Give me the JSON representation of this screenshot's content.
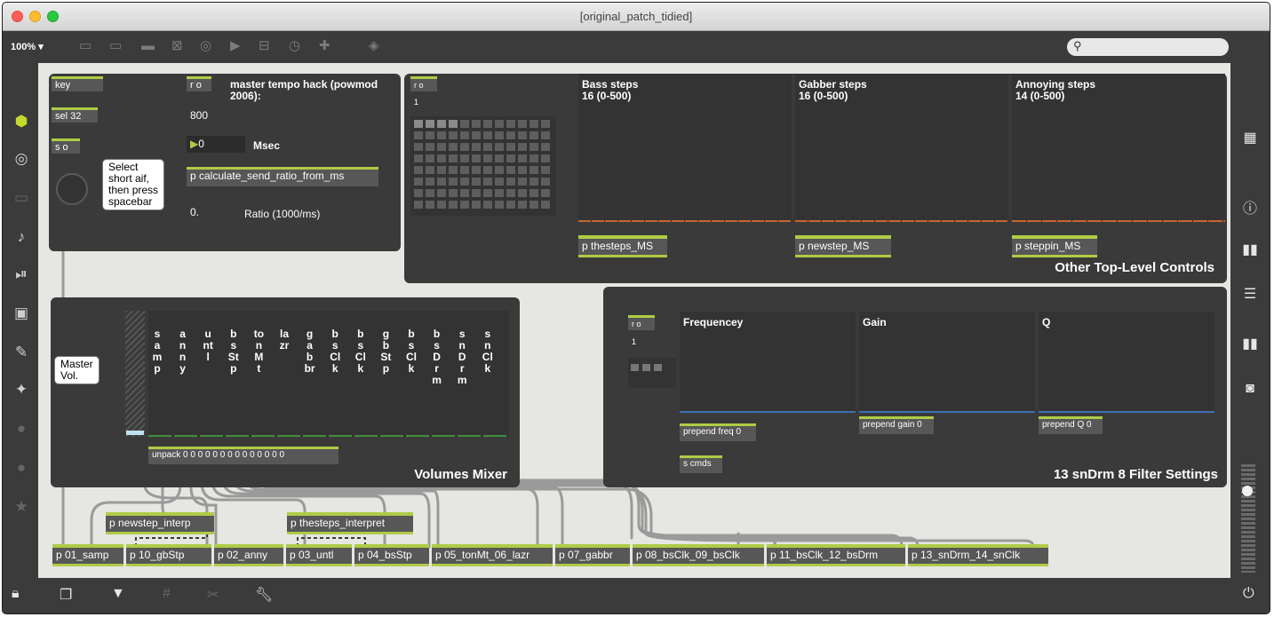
{
  "window": {
    "title": "[original_patch_tidied]"
  },
  "toolbar": {
    "zoom": "100% ▾",
    "search_glyph": "⚲"
  },
  "top_left_panel": {
    "key_label": "key",
    "sel_label": "sel 32",
    "s_o_label": "s o",
    "r_o_label": "r o",
    "heading": "master tempo hack (powmod\n2006):",
    "value_800": "800",
    "msec_value": "0",
    "msec_label": "Msec",
    "calc_label": "p calculate_send_ratio_from_ms",
    "ratio_value": "0.",
    "ratio_label": "Ratio (1000/ms)",
    "bubble_text": "Select\nshort aif,\nthen press\nspacebar"
  },
  "steps_panel": {
    "r_o_label": "r o",
    "value_1": "1",
    "plots": [
      {
        "heading": "Bass steps\n16 (0-500)",
        "patcher": "p thesteps_MS"
      },
      {
        "heading": "Gabber steps\n16 (0-500)",
        "patcher": "p newstep_MS"
      },
      {
        "heading": "Annoying steps\n14 (0-500)",
        "patcher": "p steppin_MS"
      }
    ],
    "title": "Other Top-Level Controls"
  },
  "volumes_panel": {
    "bubble_text": "Master\nVol.",
    "columns": [
      "samp",
      "anny",
      "untl",
      "bsStp",
      "tonMt",
      "lazr",
      "gabbr",
      "bsClk",
      "bsClk",
      "gbStp",
      "bsClk",
      "bsDrm",
      "snDrm",
      "snClk"
    ],
    "unpack_label": "unpack 0 0 0 0 0 0 0 0 0 0 0 0 0 0",
    "title": "Volumes Mixer"
  },
  "filter_panel": {
    "r_o_label": "r o",
    "value_1": "1",
    "plots": [
      "Frequencey",
      "Gain",
      "Q"
    ],
    "prepend_freq": "prepend freq 0",
    "prepend_gain": "prepend gain 0",
    "prepend_q": "prepend Q 0",
    "s_cmds": "s cmds",
    "title": "13 snDrm 8 Filter Settings"
  },
  "patchers": {
    "newstep_interp": "p newstep_interp",
    "thesteps_interpret": "p thesteps_interpret",
    "bottom_row": [
      "p 01_samp",
      "p 10_gbStp",
      "p 02_anny",
      "p 03_untl",
      "p 04_bsStp",
      "p 05_tonMt_06_lazr",
      "p 07_gabbr",
      "p 08_bsClk_09_bsClk",
      "p 11_bsClk_12_bsDrm",
      "p 13_snDrm_14_snClk"
    ]
  },
  "colors": {
    "accent": "#afcc45",
    "panel": "#3a3a3a",
    "canvas": "#e6e6e2",
    "plot_line_orange": "#c8642d",
    "plot_line_blue": "#3f6fb5"
  }
}
